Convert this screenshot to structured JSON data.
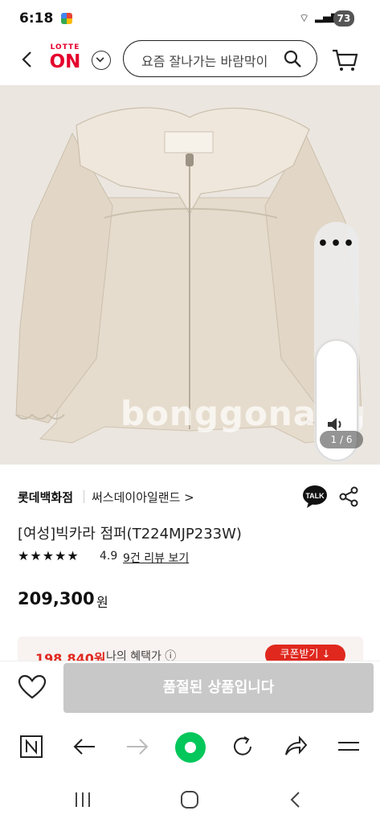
{
  "status": {
    "time": "6:18",
    "battery": "73"
  },
  "header": {
    "logo_top": "LOTTE",
    "logo_main": "ON",
    "search_placeholder": "요즘 잘나가는 바람막이"
  },
  "hero": {
    "watermark": "bonggonang",
    "counter": "1 / 6"
  },
  "product": {
    "store": "롯데백화점",
    "brand": "써스데이아일랜드 >",
    "talk_label": "TALK",
    "name": "[여성]빅카라 점퍼(T224MJP233W)",
    "stars": "★★★★★",
    "rating": "4.9",
    "reviews": "9건 리뷰 보기",
    "price": "209,300",
    "currency": "원",
    "coupon_price": "198,840원",
    "coupon_label": "나의 혜택가 ⓘ",
    "coupon_button": "쿠폰받기 ↓"
  },
  "buy": {
    "soldout": "품절된 상품입니다"
  },
  "colors": {
    "brand_red": "#e4002b",
    "accent_green": "#03c75a",
    "soldout_gray": "#c8c8c8"
  }
}
